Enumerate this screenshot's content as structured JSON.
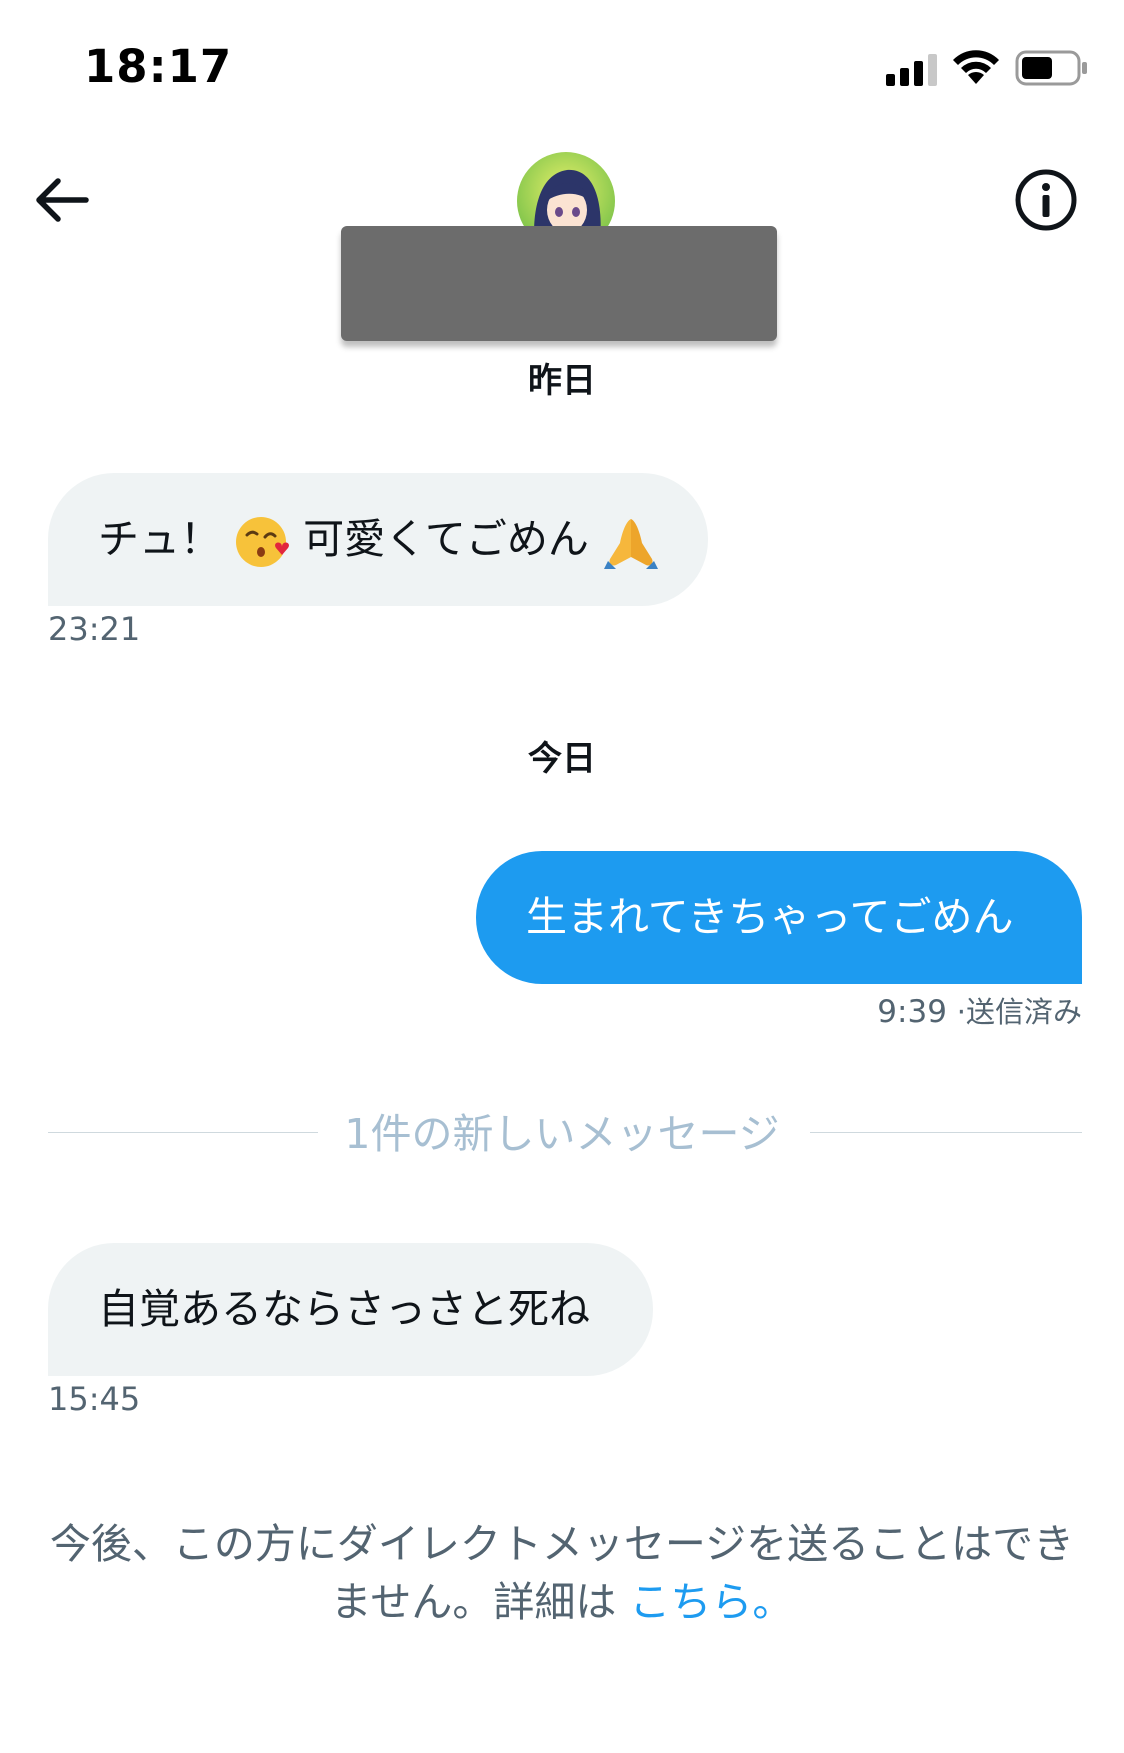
{
  "status_bar": {
    "time": "18:17"
  },
  "header": {
    "back_icon": "arrow-left-icon",
    "info_icon": "info-circle-icon"
  },
  "conversation": {
    "yesterday_label": "昨日",
    "today_label": "今日",
    "messages": [
      {
        "direction": "incoming",
        "text_before": "チュ！",
        "emoji_1": "kiss-heart-emoji",
        "text_middle": "可愛くてごめん",
        "emoji_2": "folded-hands-emoji",
        "time": "23:21"
      },
      {
        "direction": "outgoing",
        "text": "生まれてきちゃってごめん",
        "time": "9:39",
        "status": "·送信済み"
      },
      {
        "direction": "incoming",
        "text": "自覚あるならさっさと死ね",
        "time": "15:45"
      }
    ],
    "new_messages_divider": "1件の新しいメッセージ"
  },
  "footer": {
    "notice": "今後、この方にダイレクトメッセージを送ることはできません。詳細は",
    "link": "こちら。"
  },
  "colors": {
    "accent": "#1d9bf0",
    "incoming_bubble": "#eff3f4",
    "secondary_text": "#536471",
    "divider_text": "#a7bfd2",
    "redaction": "#6c6c6c"
  }
}
